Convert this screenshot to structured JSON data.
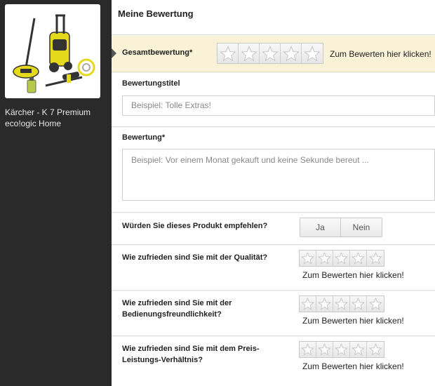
{
  "product": {
    "name": "Kärcher - K 7 Premium eco!ogic Home"
  },
  "main": {
    "title": "Meine Bewertung"
  },
  "overall": {
    "label": "Gesamtbewertung*",
    "rating": 0,
    "max": 5,
    "hint": "Zum Bewerten hier klicken!"
  },
  "review_title": {
    "label": "Bewertungstitel",
    "placeholder": "Beispiel: Tolle Extras!"
  },
  "review_text": {
    "label": "Bewertung*",
    "placeholder": "Beispiel: Vor einem Monat gekauft und keine Sekunde bereut ..."
  },
  "recommend": {
    "question": "Würden Sie dieses Produkt empfehlen?",
    "yes": "Ja",
    "no": "Nein"
  },
  "quality": {
    "question": "Wie zufrieden sind Sie mit der Qualität?",
    "rating": 0,
    "hint": "Zum Bewerten hier klicken!"
  },
  "usability": {
    "question": "Wie zufrieden sind Sie mit der Bedienungsfreundlichkeit?",
    "rating": 0,
    "hint": "Zum Bewerten hier klicken!"
  },
  "price": {
    "question": "Wie zufrieden sind Sie mit dem Preis-Leistungs-Verhältnis?",
    "rating": 0,
    "hint": "Zum Bewerten hier klicken!"
  },
  "icons": {
    "star": "star-outline-icon",
    "arrow": "caret-right-icon"
  },
  "colors": {
    "sidebar": "#2a2a2a",
    "highlight": "#f9f2d7",
    "machine_yellow": "#e5d91c"
  }
}
